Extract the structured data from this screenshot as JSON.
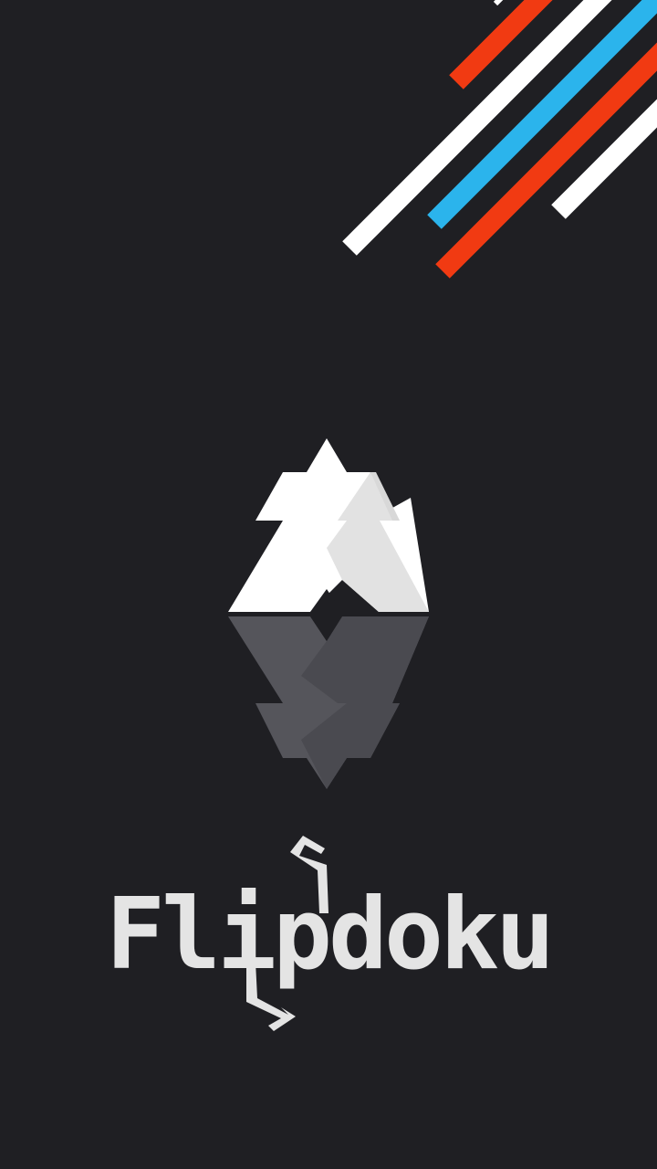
{
  "app": {
    "title": "Flipdoku"
  },
  "splash": {
    "logo_icon": "triangle-flip-logo",
    "decoration": "diagonal-stripes"
  },
  "colors": {
    "background": "#1f1f23",
    "stripe_red": "#f13a12",
    "stripe_white": "#ffffff",
    "stripe_blue": "#2bb4ec",
    "logo_white": "#ffffff",
    "logo_shade": "#e0e0e0",
    "reflection": "#55555b",
    "reflection_dark": "#46464c",
    "title": "#e4e4e4"
  }
}
